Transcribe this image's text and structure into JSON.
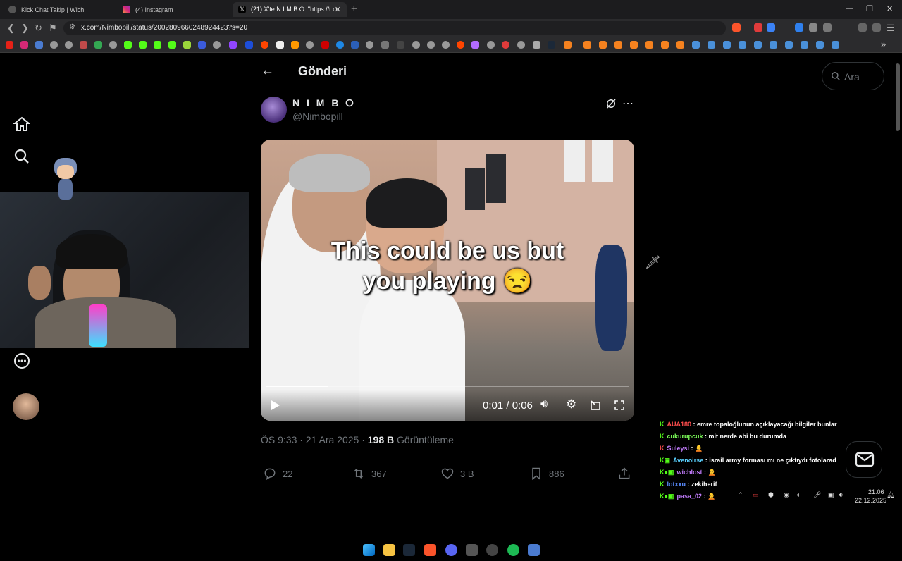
{
  "tabs": [
    {
      "title": "Kick Chat Takip | Wich",
      "active": false
    },
    {
      "title": "(4) Instagram",
      "active": false
    },
    {
      "title": "(21) X'te N I M B ⭘: \"https://t.co",
      "active": true
    }
  ],
  "url": "x.com/Nimbopill/status/2002809660248924423?s=20",
  "header": {
    "title": "Gönderi"
  },
  "search": {
    "placeholder": "Ara"
  },
  "post": {
    "author_name": "N I M B ⭘",
    "author_handle": "@Nimbopill",
    "video": {
      "caption_line1": "This could be us but",
      "caption_line2": "you playing 😒",
      "time": "0:01 / 0:06",
      "progress": 0.17
    },
    "timestamp": "ÖS 9:33 · 21 Ara 2025 · ",
    "views_count": "198 B",
    "views_label": " Görüntüleme",
    "stats": {
      "replies": "22",
      "reposts": "367",
      "likes": "3 B",
      "bookmarks": "886"
    }
  },
  "chat": [
    {
      "user": "AUA180",
      "color": "#ff4d4d",
      "text": " : emre topaloğlunun açıklayacağı bilgiler bunlar"
    },
    {
      "user": "cukurupcuk",
      "color": "#7dff5a",
      "text": " : mit nerde abi bu durumda"
    },
    {
      "user": "Suleysi",
      "color": "#c47dff",
      "text": " : 🧑‍🦲"
    },
    {
      "user": "Avenoirse",
      "color": "#5ad1ff",
      "text": " : israil army forması mı ne çıktıydı fotolarad"
    },
    {
      "user": "wichlost",
      "color": "#c47dff",
      "text": " : 🧑‍🦲"
    },
    {
      "user": "lotxxu",
      "color": "#5a8cff",
      "text": " : zekiherif"
    },
    {
      "user": "pasa_02",
      "color": "#c47dff",
      "text": " : 🧑‍🦲"
    }
  ],
  "clock": {
    "time": "21:06",
    "date": "22.12.2025"
  },
  "colors": {
    "accent": "#1d9bf0",
    "kick": "#53fc18"
  }
}
